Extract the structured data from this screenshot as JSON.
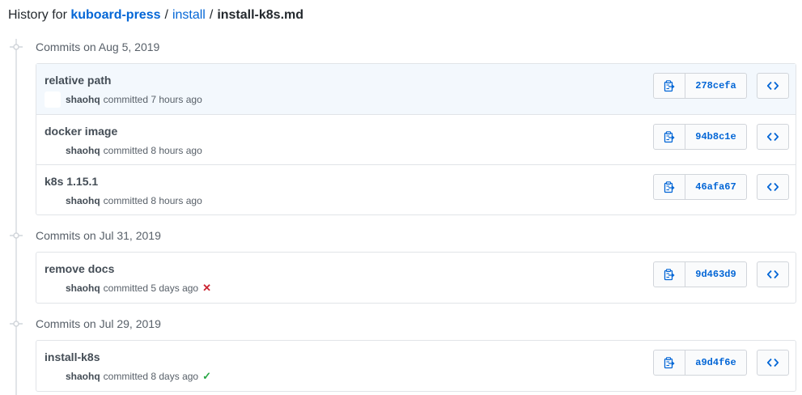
{
  "header": {
    "prefix": "History for",
    "repo": "kuboard-press",
    "sep1": "/",
    "dir": "install",
    "sep2": "/",
    "file": "install-k8s.md"
  },
  "icons": {
    "timeline": "git-commit-icon",
    "copy": "clippy-icon",
    "browse": "code-icon",
    "fail": "x-icon",
    "success": "check-icon"
  },
  "colors": {
    "link": "#0366d6",
    "fail": "#cb2431",
    "success": "#28a745"
  },
  "days": [
    {
      "label": "Commits on Aug 5, 2019",
      "commits": [
        {
          "title": "relative path",
          "author": "shaohq",
          "action": "committed",
          "time": "7 hours ago",
          "sha": "278cefa",
          "status": ""
        },
        {
          "title": "docker image",
          "author": "shaohq",
          "action": "committed",
          "time": "8 hours ago",
          "sha": "94b8c1e",
          "status": ""
        },
        {
          "title": "k8s 1.15.1",
          "author": "shaohq",
          "action": "committed",
          "time": "8 hours ago",
          "sha": "46afa67",
          "status": ""
        }
      ]
    },
    {
      "label": "Commits on Jul 31, 2019",
      "commits": [
        {
          "title": "remove docs",
          "author": "shaohq",
          "action": "committed",
          "time": "5 days ago",
          "sha": "9d463d9",
          "status": "failure"
        }
      ]
    },
    {
      "label": "Commits on Jul 29, 2019",
      "commits": [
        {
          "title": "install-k8s",
          "author": "shaohq",
          "action": "committed",
          "time": "8 days ago",
          "sha": "a9d4f6e",
          "status": "success"
        }
      ]
    }
  ]
}
